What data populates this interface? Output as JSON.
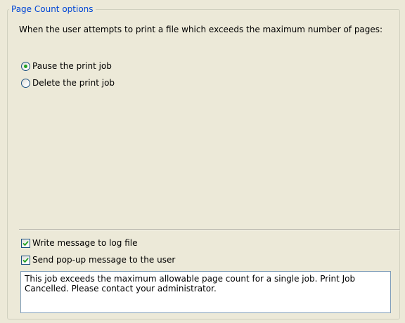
{
  "group": {
    "legend": "Page Count options",
    "description": "When the user attempts to print a file which exceeds the maximum number of pages:"
  },
  "action_options": [
    {
      "label": "Pause the print job",
      "checked": true
    },
    {
      "label": "Delete the print job",
      "checked": false
    }
  ],
  "notifications": {
    "log_file": {
      "label": "Write message to log file",
      "checked": true
    },
    "popup": {
      "label": "Send pop-up message to the user",
      "checked": true
    },
    "message_text": "This job exceeds the maximum allowable page count for a single job. Print Job Cancelled. Please contact your administrator."
  },
  "colors": {
    "legend": "#0046d5",
    "radio_dot": "#21a121",
    "check_mark": "#21a121",
    "control_border": "#1c5180"
  }
}
